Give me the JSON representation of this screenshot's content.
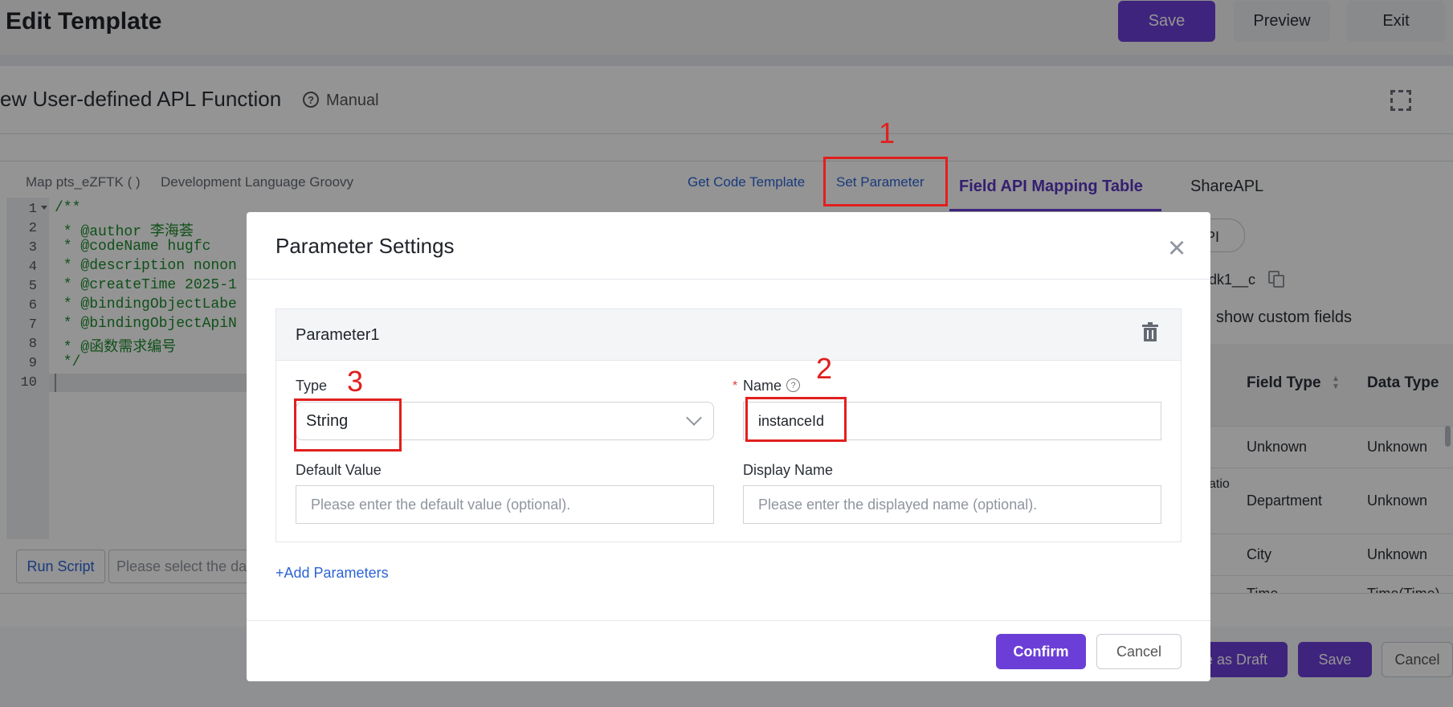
{
  "header": {
    "title": "Edit Template",
    "save": "Save",
    "preview": "Preview",
    "exit": "Exit"
  },
  "panel": {
    "title": "ew User-defined APL Function",
    "manual": "Manual",
    "map_label": "Map pts_eZFTK ( )",
    "dev_language": "Development Language Groovy",
    "get_code_template": "Get Code Template",
    "set_parameter": "Set Parameter",
    "tabs": [
      "Field API Mapping Table",
      "ShareAPL"
    ]
  },
  "editor": {
    "line_numbers": [
      "1",
      "2",
      "3",
      "4",
      "5",
      "6",
      "7",
      "8",
      "9",
      "10"
    ],
    "lines": [
      "/**",
      " * @author 李海荟",
      " * @codeName hugfc",
      " * @description nonon",
      " * @createTime 2025-1",
      " * @bindingObjectLabe",
      " * @bindingObjectApiN",
      " * @函数需求编号",
      " */",
      ""
    ],
    "run_script": "Run Script",
    "data_select_placeholder": "Please select the dat"
  },
  "right": {
    "api_button": "PI",
    "api_name": "dk1__c",
    "show_custom": "show custom fields",
    "columns": [
      "Field Type",
      "Data Type"
    ],
    "rows": [
      {
        "left": "",
        "field_type": "Unknown",
        "data_type": "Unknown"
      },
      {
        "left": "atio",
        "field_type": "Department",
        "data_type": "Unknown"
      },
      {
        "left": "",
        "field_type": "City",
        "data_type": "Unknown"
      },
      {
        "left": "",
        "field_type": "Time",
        "data_type": "Time(Time)"
      }
    ],
    "save_draft": "e as Draft",
    "save": "Save",
    "cancel": "Cancel"
  },
  "modal": {
    "title": "Parameter Settings",
    "param_title": "Parameter1",
    "type_label": "Type",
    "type_value": "String",
    "name_label": "Name",
    "name_value": "instanceId",
    "default_label": "Default Value",
    "default_placeholder": "Please enter the default value (optional).",
    "display_label": "Display Name",
    "display_placeholder": "Please enter the displayed name (optional).",
    "add_params": "+Add Parameters",
    "confirm": "Confirm",
    "cancel": "Cancel"
  },
  "annotations": {
    "one": "1",
    "two": "2",
    "three": "3"
  },
  "colors": {
    "accent": "#6b3fd7",
    "link": "#2d64d6",
    "annotation": "#e0201e"
  }
}
